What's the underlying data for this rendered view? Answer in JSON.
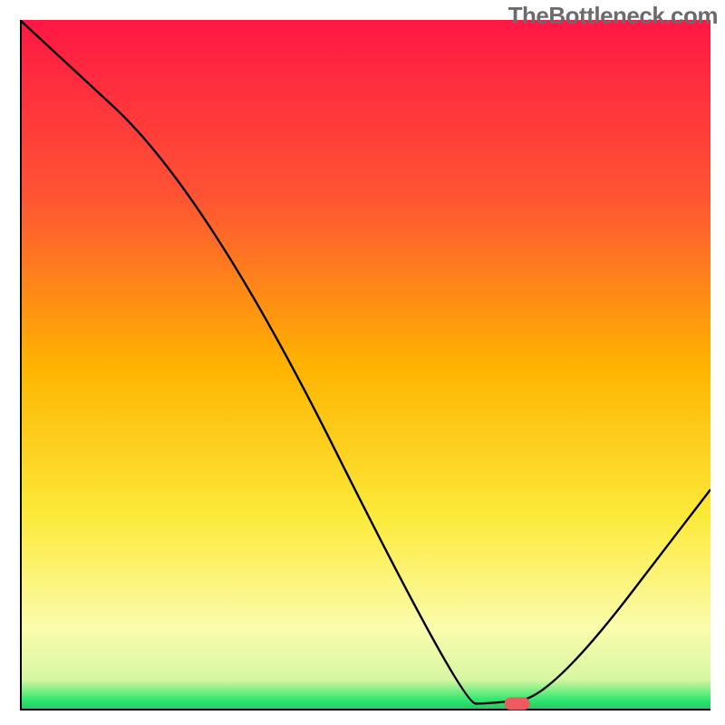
{
  "watermark": "TheBottleneck.com",
  "chart_data": {
    "type": "line",
    "title": "",
    "xlabel": "",
    "ylabel": "",
    "xlim": [
      0,
      100
    ],
    "ylim": [
      0,
      100
    ],
    "grid": false,
    "legend": false,
    "x": [
      0,
      27,
      64,
      68,
      77,
      100
    ],
    "values": [
      100,
      75,
      1,
      1,
      2,
      32
    ],
    "gradient_stops": [
      {
        "offset": 0.0,
        "color": "#ff1744"
      },
      {
        "offset": 0.26,
        "color": "#ff5533"
      },
      {
        "offset": 0.5,
        "color": "#ffb300"
      },
      {
        "offset": 0.72,
        "color": "#fcea3a"
      },
      {
        "offset": 0.88,
        "color": "#fbfcad"
      },
      {
        "offset": 0.955,
        "color": "#d7f7a2"
      },
      {
        "offset": 0.985,
        "color": "#2ee66e"
      },
      {
        "offset": 1.0,
        "color": "#22c55e"
      }
    ],
    "marker": {
      "x": 72,
      "y": 1,
      "color": "#ec5b62",
      "rx": 14,
      "ry": 7
    }
  }
}
